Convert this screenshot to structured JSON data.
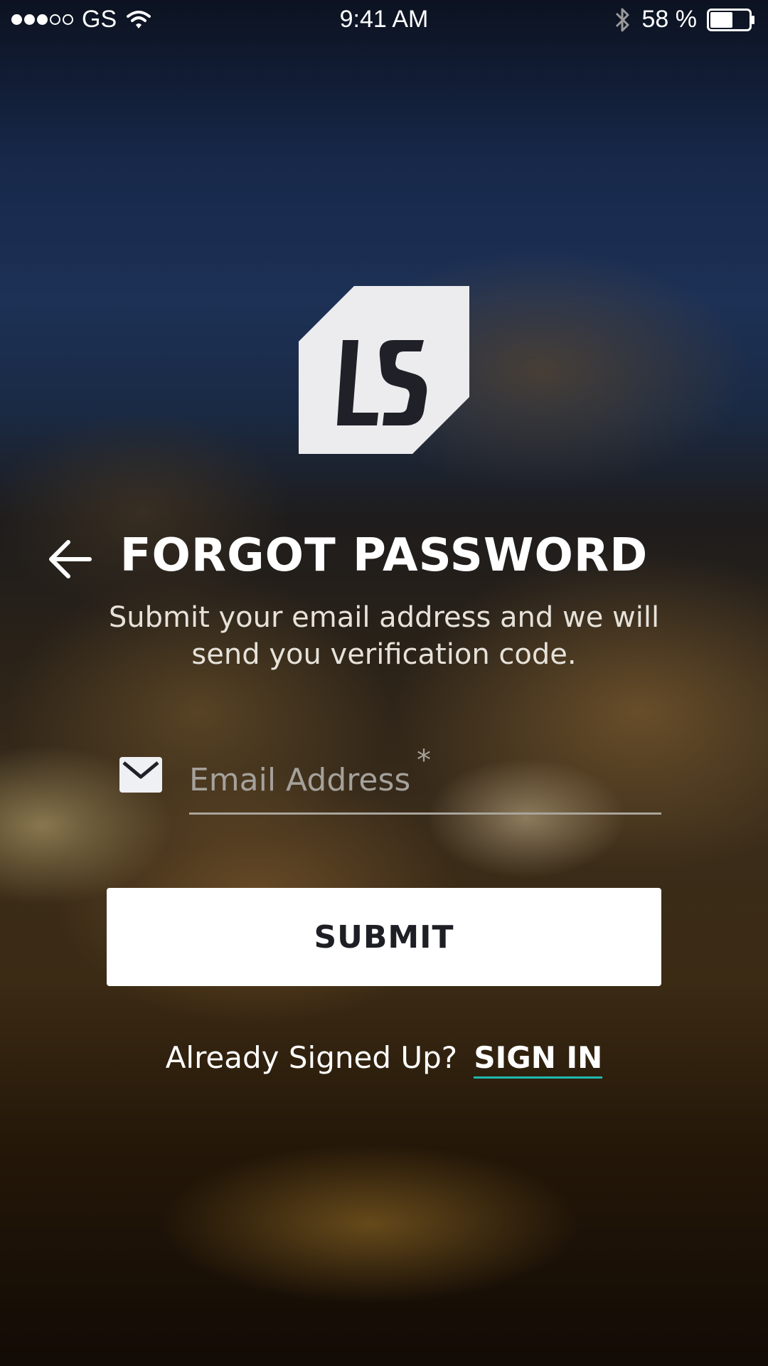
{
  "status_bar": {
    "carrier": "GS",
    "time": "9:41 AM",
    "battery": "58 %",
    "signal_bars_filled": 3,
    "signal_bars_total": 5,
    "battery_level": 0.58
  },
  "logo": {
    "text": "LS",
    "icon": "ls-brand-logo"
  },
  "header": {
    "back_icon": "arrow-left-icon",
    "title": "FORGOT PASSWORD",
    "subtitle": "Submit your email address and we will send you verification code."
  },
  "form": {
    "email_icon": "envelope-icon",
    "email_placeholder": "Email Address",
    "email_value": "",
    "required_marker": "*",
    "submit_label": "SUBMIT"
  },
  "footer": {
    "prompt": "Already Signed Up?",
    "signin_label": "SIGN IN"
  },
  "colors": {
    "accent": "#1fb9b0",
    "button_bg": "#ffffff",
    "button_text": "#1e1f24"
  }
}
